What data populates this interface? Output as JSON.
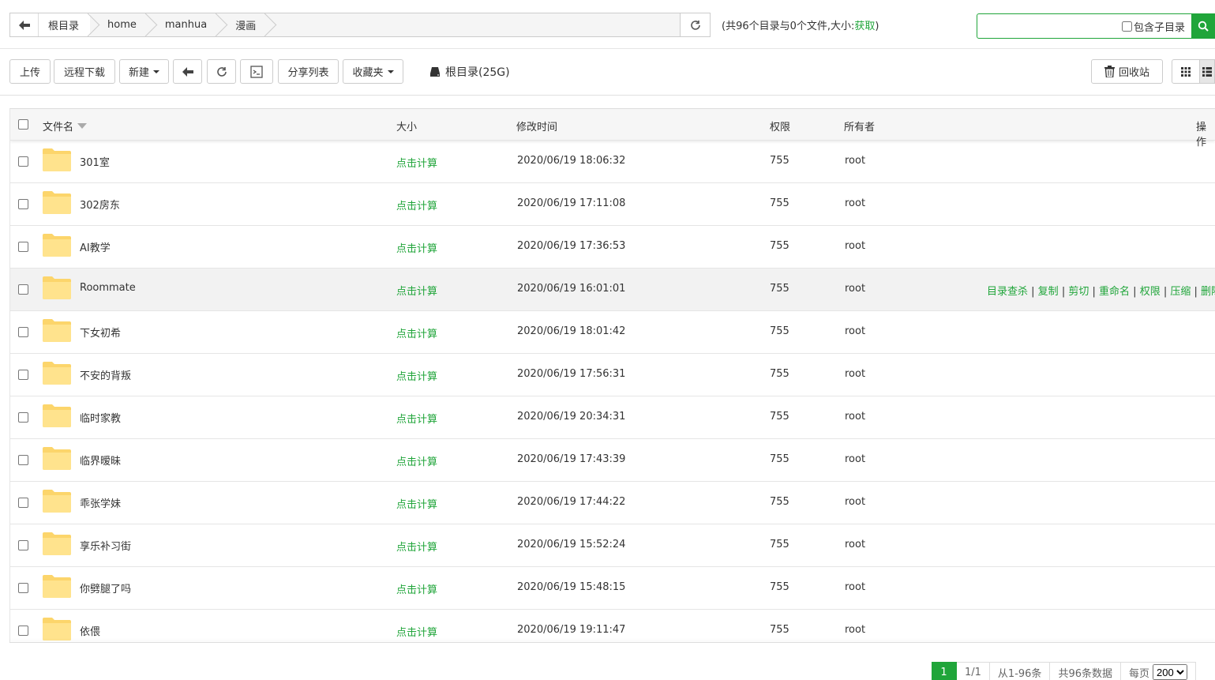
{
  "path": {
    "crumbs": [
      "根目录",
      "home",
      "manhua",
      "漫画"
    ],
    "info_prefix": "(共96个目录与0个文件,大小:",
    "info_get": "获取",
    "info_suffix": ")"
  },
  "search": {
    "placeholder": "",
    "subdir_label": "包含子目录"
  },
  "toolbar": {
    "upload": "上传",
    "remote_download": "远程下载",
    "new": "新建",
    "share_list": "分享列表",
    "favorites": "收藏夹",
    "disk": "根目录(25G)",
    "recycle": "回收站"
  },
  "columns": {
    "name": "文件名",
    "size": "大小",
    "mtime": "修改时间",
    "perm": "权限",
    "owner": "所有者",
    "ops": "操作"
  },
  "rows": [
    {
      "name": "301室",
      "size": "点击计算",
      "mtime": "2020/06/19 18:06:32",
      "perm": "755",
      "owner": "root"
    },
    {
      "name": "302房东",
      "size": "点击计算",
      "mtime": "2020/06/19 17:11:08",
      "perm": "755",
      "owner": "root"
    },
    {
      "name": "AI教学",
      "size": "点击计算",
      "mtime": "2020/06/19 17:36:53",
      "perm": "755",
      "owner": "root"
    },
    {
      "name": "Roommate",
      "size": "点击计算",
      "mtime": "2020/06/19 16:01:01",
      "perm": "755",
      "owner": "root"
    },
    {
      "name": "下女初希",
      "size": "点击计算",
      "mtime": "2020/06/19 18:01:42",
      "perm": "755",
      "owner": "root"
    },
    {
      "name": "不安的背叛",
      "size": "点击计算",
      "mtime": "2020/06/19 17:56:31",
      "perm": "755",
      "owner": "root"
    },
    {
      "name": "临时家教",
      "size": "点击计算",
      "mtime": "2020/06/19 20:34:31",
      "perm": "755",
      "owner": "root"
    },
    {
      "name": "临界暧昧",
      "size": "点击计算",
      "mtime": "2020/06/19 17:43:39",
      "perm": "755",
      "owner": "root"
    },
    {
      "name": "乖张学妹",
      "size": "点击计算",
      "mtime": "2020/06/19 17:44:22",
      "perm": "755",
      "owner": "root"
    },
    {
      "name": "享乐补习街",
      "size": "点击计算",
      "mtime": "2020/06/19 15:52:24",
      "perm": "755",
      "owner": "root"
    },
    {
      "name": "你劈腿了吗",
      "size": "点击计算",
      "mtime": "2020/06/19 15:48:15",
      "perm": "755",
      "owner": "root"
    },
    {
      "name": "依偎",
      "size": "点击计算",
      "mtime": "2020/06/19 19:11:47",
      "perm": "755",
      "owner": "root"
    }
  ],
  "row_ops": [
    "目录查杀",
    "复制",
    "剪切",
    "重命名",
    "权限",
    "压缩",
    "删除"
  ],
  "pager": {
    "current": "1",
    "pages": "1/1",
    "range": "从1-96条",
    "total": "共96条数据",
    "per_page_label": "每页",
    "per_page_value": "200"
  },
  "colors": {
    "accent": "#20a53a",
    "folder": "#ffe07a"
  }
}
